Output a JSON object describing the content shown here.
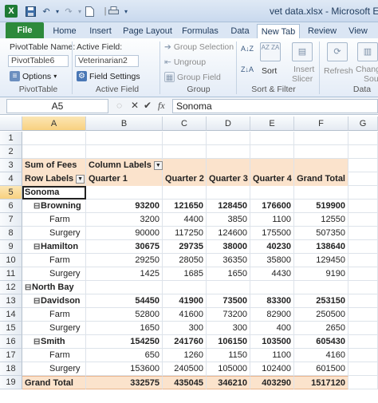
{
  "window": {
    "title": "vet data.xlsx - Microsoft Ex"
  },
  "icons": {
    "excel": "excel-icon",
    "save": "save-icon",
    "undo": "undo-icon",
    "redo": "redo-icon",
    "new": "new-doc-icon",
    "print": "print-icon",
    "qat_more": "chevron-down-icon"
  },
  "tabs": [
    {
      "label": "File"
    },
    {
      "label": "Home"
    },
    {
      "label": "Insert"
    },
    {
      "label": "Page Layout"
    },
    {
      "label": "Formulas"
    },
    {
      "label": "Data"
    },
    {
      "label": "New Tab"
    },
    {
      "label": "Review"
    },
    {
      "label": "View"
    }
  ],
  "ribbon": {
    "pivot_name_label": "PivotTable Name:",
    "pivot_name_value": "PivotTable6",
    "options_label": "Options",
    "group_pivottable": "PivotTable",
    "active_field_label": "Active Field:",
    "active_field_value": "Veterinarian2",
    "field_settings_label": "Field Settings",
    "group_active_field": "Active Field",
    "group_selection": "Group Selection",
    "ungroup": "Ungroup",
    "group_field": "Group Field",
    "group_group": "Group",
    "sort": "Sort",
    "group_sort_filter": "Sort & Filter",
    "insert_slicer": "Insert Slicer",
    "insert_label": "Insert",
    "slicer_label": "Slicer",
    "refresh": "Refresh",
    "change_label": "Chang",
    "source_label": "Sou",
    "group_data": "Data",
    "sort_az": "A↓Z",
    "sort_za": "Z↓A",
    "sort_box": "AZ ZA"
  },
  "formula_bar": {
    "name_box": "A5",
    "fx": "fx",
    "content": "Sonoma"
  },
  "grid": {
    "columns": [
      "A",
      "B",
      "C",
      "D",
      "E",
      "F",
      "G"
    ],
    "rows": [
      {
        "num": "1",
        "cells": [
          "",
          "",
          "",
          "",
          "",
          ""
        ]
      },
      {
        "num": "2",
        "cells": [
          "",
          "",
          "",
          "",
          "",
          ""
        ]
      },
      {
        "num": "3",
        "cells": [
          "Sum of Fees",
          "Column Labels",
          "",
          "",
          "",
          ""
        ]
      },
      {
        "num": "4",
        "cells": [
          "Row Labels",
          "Quarter 1",
          "Quarter 2",
          "Quarter 3",
          "Quarter 4",
          "Grand Total"
        ]
      },
      {
        "num": "5",
        "cells": [
          "Sonoma",
          "",
          "",
          "",
          "",
          ""
        ]
      },
      {
        "num": "6",
        "cells": [
          "Browning",
          "93200",
          "121650",
          "128450",
          "176600",
          "519900"
        ]
      },
      {
        "num": "7",
        "cells": [
          "Farm",
          "3200",
          "4400",
          "3850",
          "1100",
          "12550"
        ]
      },
      {
        "num": "8",
        "cells": [
          "Surgery",
          "90000",
          "117250",
          "124600",
          "175500",
          "507350"
        ]
      },
      {
        "num": "9",
        "cells": [
          "Hamilton",
          "30675",
          "29735",
          "38000",
          "40230",
          "138640"
        ]
      },
      {
        "num": "10",
        "cells": [
          "Farm",
          "29250",
          "28050",
          "36350",
          "35800",
          "129450"
        ]
      },
      {
        "num": "11",
        "cells": [
          "Surgery",
          "1425",
          "1685",
          "1650",
          "4430",
          "9190"
        ]
      },
      {
        "num": "12",
        "cells": [
          "North Bay",
          "",
          "",
          "",
          "",
          ""
        ]
      },
      {
        "num": "13",
        "cells": [
          "Davidson",
          "54450",
          "41900",
          "73500",
          "83300",
          "253150"
        ]
      },
      {
        "num": "14",
        "cells": [
          "Farm",
          "52800",
          "41600",
          "73200",
          "82900",
          "250500"
        ]
      },
      {
        "num": "15",
        "cells": [
          "Surgery",
          "1650",
          "300",
          "300",
          "400",
          "2650"
        ]
      },
      {
        "num": "16",
        "cells": [
          "Smith",
          "154250",
          "241760",
          "106150",
          "103500",
          "605430"
        ]
      },
      {
        "num": "17",
        "cells": [
          "Farm",
          "650",
          "1260",
          "1150",
          "1100",
          "4160"
        ]
      },
      {
        "num": "18",
        "cells": [
          "Surgery",
          "153600",
          "240500",
          "105000",
          "102400",
          "601500"
        ]
      },
      {
        "num": "19",
        "cells": [
          "Grand Total",
          "332575",
          "435045",
          "346210",
          "403290",
          "1517120"
        ]
      }
    ]
  }
}
